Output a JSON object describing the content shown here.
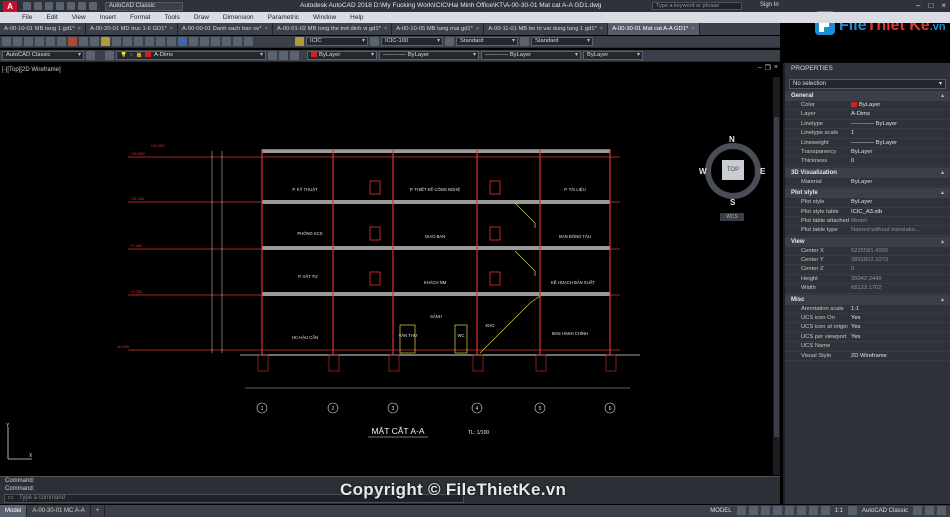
{
  "app": {
    "logo": "A",
    "workspace": "AutoCAD Classic",
    "title": "Autodesk AutoCAD 2018    D:\\My Fucking Work\\ICIC\\Hai Minh Office\\KT\\A-00-30-01 Mat cat A-A GD1.dwg",
    "search_placeholder": "Type a keyword or phrase",
    "signin": "Sign In"
  },
  "brand_logo": {
    "file": "File",
    "rest": "Thiết Kế",
    "vn": ".vn"
  },
  "menu": [
    "File",
    "Edit",
    "View",
    "Insert",
    "Format",
    "Tools",
    "Draw",
    "Dimension",
    "Parametric",
    "Window",
    "Help"
  ],
  "doc_tabs": [
    "A-00-10-01 MB tang 1 gd1*",
    "A-00-20-01 MD truc 1-6 GD1*",
    "A-00-00-01 Danh sach ban ve*",
    "A-00-01-02 MB tong the tret dinh vi gd1*",
    "A-00-10-05 MB tang mai gd1*",
    "A-00-11-01 MB bo tri vat dung tang 1 gd1*",
    "A-00-30-01 Mat cat A-A GD1*"
  ],
  "toolbar1": {
    "textstyle": "ICIC",
    "dimstyle": "ICIC-100",
    "tablestyle": "Standard",
    "mleaderstyle": "Standard"
  },
  "toolbar2": {
    "workspace": "AutoCAD Classic",
    "layer": "A-Dims",
    "color": "ByLayer",
    "linetype": "ByLayer",
    "lineweight": "ByLayer",
    "plotstyle": "ByLayer"
  },
  "viewport": {
    "label": "[-][Top][2D Wireframe]",
    "compass": {
      "n": "N",
      "s": "S",
      "e": "E",
      "w": "W",
      "top": "TOP"
    },
    "wcs": "WCS"
  },
  "drawing": {
    "section_title": "MẶT CẮT A-A",
    "scale": "TL: 1/100",
    "rooms": [
      "P. KỸ THUẬT",
      "P. THIẾT KẾ CÔNG NGHỆ",
      "P. TÀI LIỆU",
      "PHÒNG KCS",
      "GIAO BAN",
      "BAN ĐÓNG TÀU",
      "P. VẬT TƯ",
      "KHÁCH NM",
      "KẾ HOẠCH BẢN XUẤT",
      "HC-HẬU CẦN",
      "SẢNH",
      "VĂN THƯ",
      "WC",
      "BAN HÀNH CHÍNH",
      "KHO"
    ],
    "grid_labels": [
      "1",
      "2",
      "3",
      "4",
      "5",
      "6"
    ]
  },
  "command": {
    "line1": "Command:",
    "line2": "Command:",
    "placeholder": "Type a command"
  },
  "status": {
    "tabs": [
      "Model",
      "A-00-30-01 MC A-A"
    ],
    "model": "MODEL",
    "scale": "1:1",
    "workspace": "AutoCAD Classic"
  },
  "watermark": "Copyright © FileThietKe.vn",
  "properties": {
    "title": "PROPERTIES",
    "selection": "No selection",
    "sections": [
      {
        "name": "General",
        "rows": [
          {
            "k": "Color",
            "v": "ByLayer",
            "swatch": "#d02020"
          },
          {
            "k": "Layer",
            "v": "A-Dims"
          },
          {
            "k": "Linetype",
            "v": "———— ByLayer"
          },
          {
            "k": "Linetype scale",
            "v": "1"
          },
          {
            "k": "Lineweight",
            "v": "———— ByLayer"
          },
          {
            "k": "Transparency",
            "v": "ByLayer"
          },
          {
            "k": "Thickness",
            "v": "0"
          }
        ]
      },
      {
        "name": "3D Visualization",
        "rows": [
          {
            "k": "Material",
            "v": "ByLayer"
          }
        ]
      },
      {
        "name": "Plot style",
        "rows": [
          {
            "k": "Plot style",
            "v": "ByLayer"
          },
          {
            "k": "Plot style table",
            "v": "ICIC_A3.stb"
          },
          {
            "k": "Plot table attached to",
            "v": "Model",
            "dim": true
          },
          {
            "k": "Plot table type",
            "v": "Named without translatio...",
            "dim": true
          }
        ]
      },
      {
        "name": "View",
        "rows": [
          {
            "k": "Center X",
            "v": "5225581.4992",
            "dim": true
          },
          {
            "k": "Center Y",
            "v": "3891822.1073",
            "dim": true
          },
          {
            "k": "Center Z",
            "v": "0",
            "dim": true
          },
          {
            "k": "Height",
            "v": "35042.2449",
            "dim": true
          },
          {
            "k": "Width",
            "v": "68123.1702",
            "dim": true
          }
        ]
      },
      {
        "name": "Misc",
        "rows": [
          {
            "k": "Annotation scale",
            "v": "1:1"
          },
          {
            "k": "UCS icon On",
            "v": "Yes"
          },
          {
            "k": "UCS icon at origin",
            "v": "Yes"
          },
          {
            "k": "UCS per viewport",
            "v": "Yes"
          },
          {
            "k": "UCS Name",
            "v": ""
          },
          {
            "k": "Visual Style",
            "v": "2D Wireframe"
          }
        ]
      }
    ]
  }
}
